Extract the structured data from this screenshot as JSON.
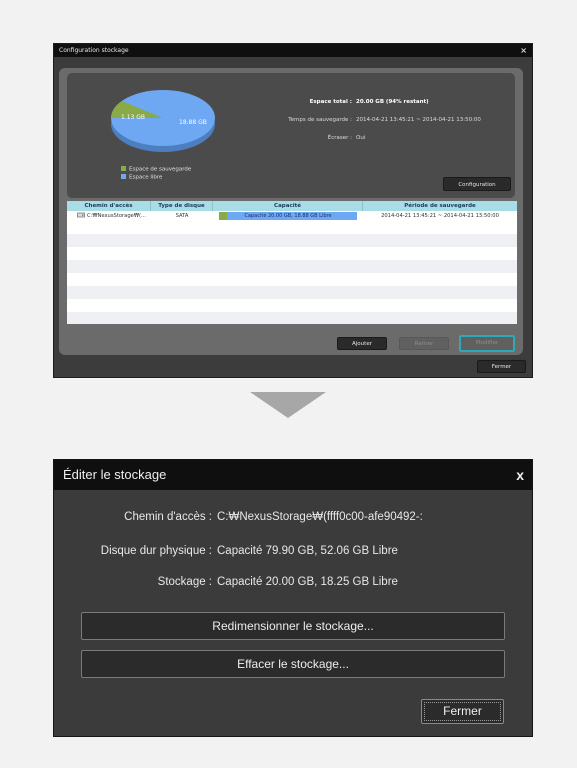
{
  "config_window": {
    "title": "Configuration stockage",
    "close_symbol": "×",
    "pie": {
      "used_label": "1.13 GB",
      "free_label": "18.88 GB",
      "used_color": "#8aaa48",
      "free_color": "#6ea7f2"
    },
    "legend": [
      {
        "label": "Espace de sauvegarde",
        "color": "#8aaa48"
      },
      {
        "label": "Espace libre",
        "color": "#6ea7f2"
      }
    ],
    "info": [
      {
        "key": "Espace total :",
        "value": "20.00 GB (94% restant)"
      },
      {
        "key": "Temps de sauvegarde :",
        "value": "2014-04-21 13:45:21 ~ 2014-04-21 13:50:00"
      },
      {
        "key": "Écraser :",
        "value": "Oui"
      }
    ],
    "configuration_button": "Configuration",
    "table": {
      "headers": [
        "Chemin d'accès",
        "Type de disque",
        "Capacité",
        "Période de sauvegarde"
      ],
      "rows": [
        {
          "path": "C:₩NexusStorage₩(...",
          "type": "SATA",
          "capacity": "Capacité 20.00 GB, 18.88 GB Libre",
          "period": "2014-04-21  13:45:21 ~ 2014-04-21  13:50:00",
          "used_fraction": 0.056
        }
      ]
    },
    "buttons": {
      "add": "Ajouter",
      "remove": "Retirer",
      "modify": "Modifier",
      "close": "Fermer"
    },
    "modify_highlight_color": "#2fa8b8"
  },
  "edit_window": {
    "title": "Éditer le stockage",
    "close_symbol": "x",
    "rows": [
      {
        "key": "Chemin d'accès :",
        "value": "C:₩NexusStorage₩(ffff0c00-afe90492-:"
      },
      {
        "key": "Disque dur physique :",
        "value": "Capacité 79.90 GB, 52.06 GB Libre"
      },
      {
        "key": "Stockage :",
        "value": "Capacité 20.00 GB, 18.25 GB Libre"
      }
    ],
    "resize_button": "Redimensionner le stockage...",
    "erase_button": "Effacer le stockage...",
    "close_button": "Fermer"
  }
}
